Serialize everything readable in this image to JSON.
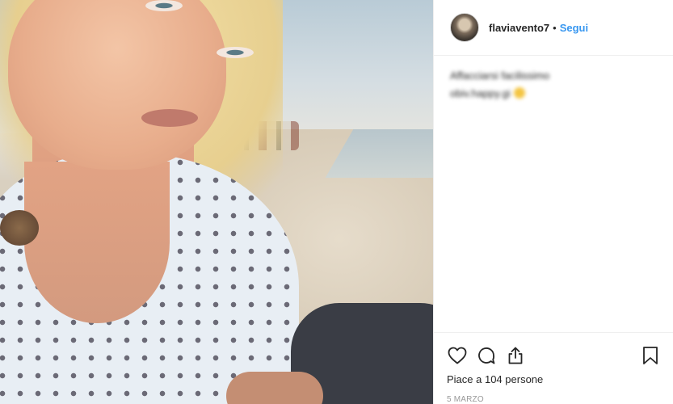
{
  "post": {
    "username": "flaviavento7",
    "separator": "•",
    "follow_label": "Segui",
    "caption_line1": "Affacciarsi facilissimo",
    "caption_line2": "obiv.happy.gi",
    "likes_text": "Piace a 104 persone",
    "date": "5 MARZO"
  },
  "icons": {
    "like": "heart-icon",
    "comment": "comment-icon",
    "share": "share-icon",
    "save": "bookmark-icon"
  },
  "colors": {
    "link": "#3897f0",
    "text": "#262626",
    "muted": "#999999",
    "divider": "#efefef"
  }
}
